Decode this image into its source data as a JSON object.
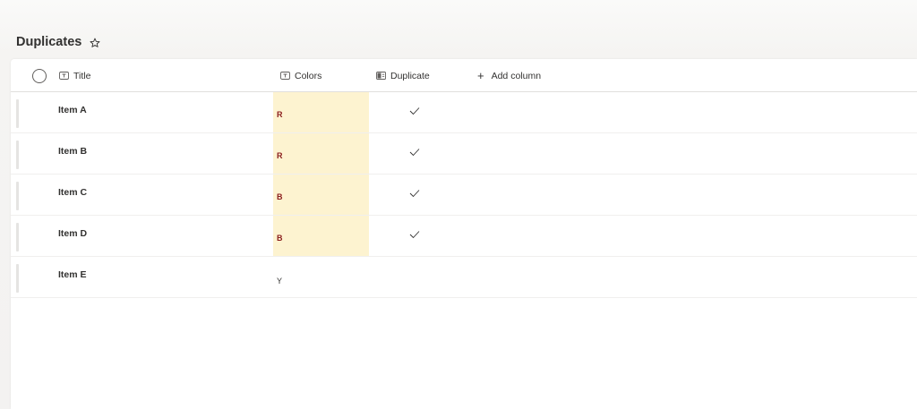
{
  "page": {
    "title": "Duplicates"
  },
  "columns": {
    "title": "Title",
    "colors": "Colors",
    "duplicate": "Duplicate",
    "add_column": "Add column"
  },
  "rows": [
    {
      "title": "Item A",
      "color": "R",
      "duplicate": true
    },
    {
      "title": "Item B",
      "color": "R",
      "duplicate": true
    },
    {
      "title": "Item C",
      "color": "B",
      "duplicate": true
    },
    {
      "title": "Item D",
      "color": "B",
      "duplicate": true
    },
    {
      "title": "Item E",
      "color": "Y",
      "duplicate": false
    }
  ],
  "colors": {
    "duplicate_highlight": "#fdf3d0",
    "duplicate_text": "#8a1c1c"
  },
  "icons": {
    "favorite": "star-outline-icon",
    "text_column": "text-column-icon",
    "calculated_column": "calculated-column-icon",
    "add": "plus-icon",
    "check": "checkmark-icon"
  }
}
